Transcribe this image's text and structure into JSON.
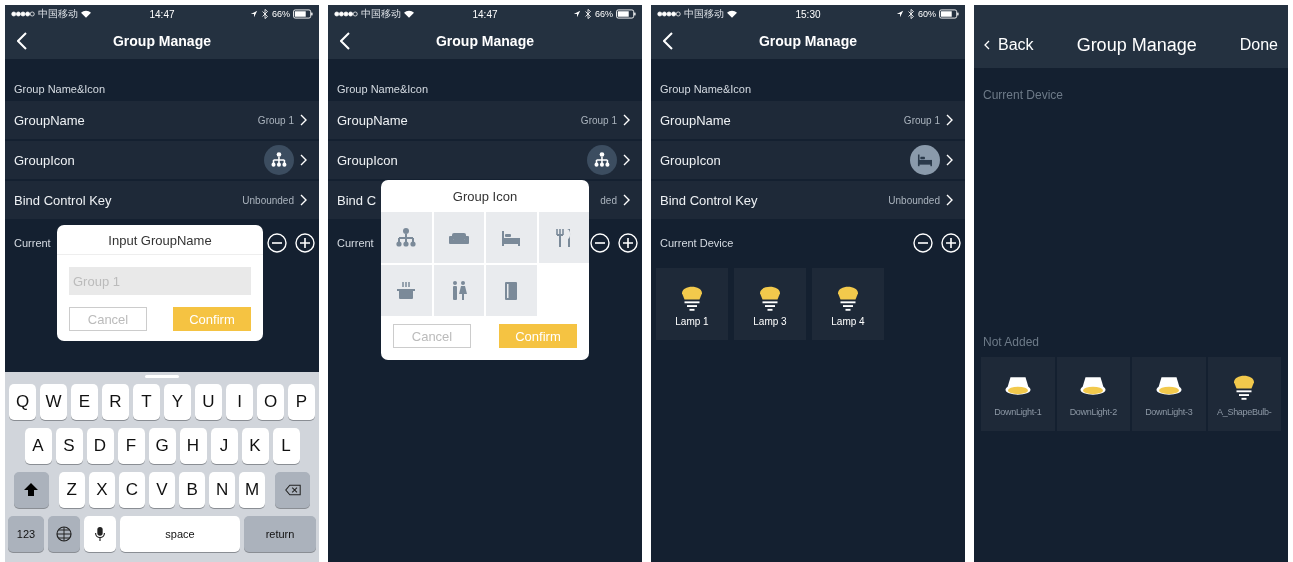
{
  "screens": [
    {
      "status_bar": {
        "carrier": "中国移动",
        "time": "14:47",
        "battery": "66%"
      },
      "nav": {
        "title": "Group Manage"
      },
      "section": "Group Name&Icon",
      "rows": [
        {
          "label": "GroupName",
          "value": "Group 1",
          "kind": "text"
        },
        {
          "label": "GroupIcon",
          "kind": "hierarchy"
        },
        {
          "label": "Bind Control Key",
          "value": "Unbounded",
          "kind": "text"
        }
      ],
      "current": {
        "label": "Current"
      },
      "dialog": {
        "kind": "input",
        "title": "Input GroupName",
        "placeholder": "Group 1",
        "cancel": "Cancel",
        "confirm": "Confirm"
      },
      "keyboard": {
        "rows": [
          [
            "Q",
            "W",
            "E",
            "R",
            "T",
            "Y",
            "U",
            "I",
            "O",
            "P"
          ],
          [
            "A",
            "S",
            "D",
            "F",
            "G",
            "H",
            "J",
            "K",
            "L"
          ],
          [
            "Z",
            "X",
            "C",
            "V",
            "B",
            "N",
            "M"
          ]
        ],
        "numbers": "123",
        "space": "space",
        "return": "return"
      }
    },
    {
      "status_bar": {
        "carrier": "中国移动",
        "time": "14:47",
        "battery": "66%"
      },
      "nav": {
        "title": "Group Manage"
      },
      "section": "Group Name&Icon",
      "rows": [
        {
          "label": "GroupName",
          "value": "Group 1",
          "kind": "text"
        },
        {
          "label": "GroupIcon",
          "kind": "hierarchy"
        },
        {
          "label": "Bind C",
          "value": "ded",
          "kind": "text"
        }
      ],
      "current": {
        "label": "Current"
      },
      "dialog": {
        "kind": "icons",
        "title": "Group Icon",
        "cancel": "Cancel",
        "confirm": "Confirm"
      }
    },
    {
      "status_bar": {
        "carrier": "中国移动",
        "time": "15:30",
        "battery": "60%"
      },
      "nav": {
        "title": "Group Manage"
      },
      "section": "Group Name&Icon",
      "rows": [
        {
          "label": "GroupName",
          "value": "Group 1",
          "kind": "text"
        },
        {
          "label": "GroupIcon",
          "kind": "bed"
        },
        {
          "label": "Bind Control Key",
          "value": "Unbounded",
          "kind": "text"
        }
      ],
      "current": {
        "label": "Current Device",
        "devices": [
          {
            "name": "Lamp 1",
            "kind": "bulb"
          },
          {
            "name": "Lamp 3",
            "kind": "bulb"
          },
          {
            "name": "Lamp 4",
            "kind": "bulb"
          }
        ]
      }
    },
    {
      "nav": {
        "title": "Group Manage",
        "back": "Back",
        "done": "Done"
      },
      "current": {
        "label": "Current Device"
      },
      "not_added": {
        "label": "Not Added",
        "devices": [
          {
            "name": "DownLight-1",
            "kind": "downlight"
          },
          {
            "name": "DownLight-2",
            "kind": "downlight"
          },
          {
            "name": "DownLight-3",
            "kind": "downlight"
          },
          {
            "name": "A_ShapeBulb-",
            "kind": "bulb"
          }
        ]
      }
    }
  ]
}
